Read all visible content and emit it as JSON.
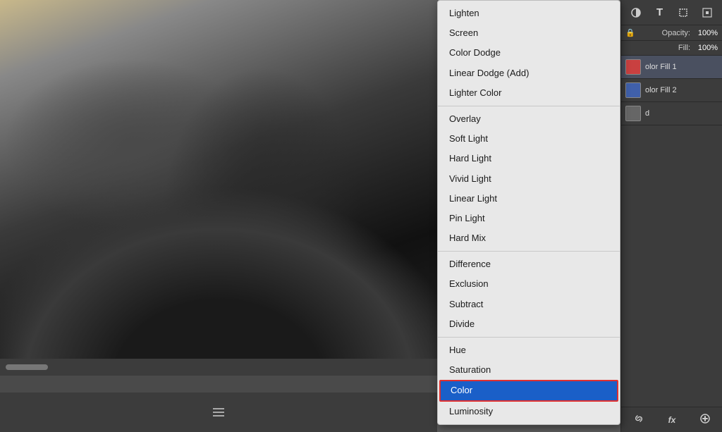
{
  "canvas": {
    "bottom_bar": "≡"
  },
  "dropdown": {
    "groups": [
      {
        "id": "lighten-group",
        "items": [
          "Lighten",
          "Screen",
          "Color Dodge",
          "Linear Dodge (Add)",
          "Lighter Color"
        ]
      },
      {
        "id": "overlay-group",
        "items": [
          "Overlay",
          "Soft Light",
          "Hard Light",
          "Vivid Light",
          "Linear Light",
          "Pin Light",
          "Hard Mix"
        ]
      },
      {
        "id": "difference-group",
        "items": [
          "Difference",
          "Exclusion",
          "Subtract",
          "Divide"
        ]
      },
      {
        "id": "color-group",
        "items": [
          "Hue",
          "Saturation",
          "Color",
          "Luminosity"
        ]
      }
    ],
    "selected_item": "Color"
  },
  "panel": {
    "toolbar_icons": [
      "circle-half",
      "T",
      "rect-select",
      "transform"
    ],
    "opacity_label": "Opacity:",
    "opacity_value": "100%",
    "fill_label": "Fill:",
    "fill_value": "100%",
    "layers": [
      {
        "name": "olor Fill 1",
        "type": "fill"
      },
      {
        "name": "olor Fill 2",
        "type": "fill"
      },
      {
        "name": "d",
        "type": "layer"
      }
    ],
    "bottom_icons": [
      "link",
      "fx",
      "circle"
    ]
  }
}
